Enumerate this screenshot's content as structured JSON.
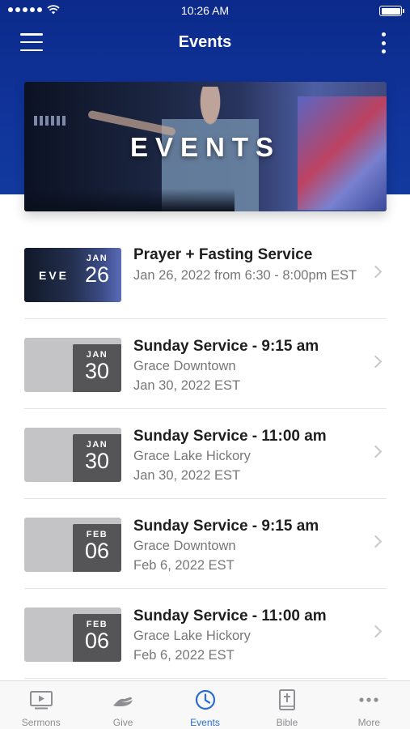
{
  "status_bar": {
    "time": "10:26 AM"
  },
  "nav": {
    "title": "Events"
  },
  "banner": {
    "text": "EVENTS"
  },
  "events": [
    {
      "title": "Prayer + Fasting Service",
      "line1": "Jan 26, 2022 from 6:30 - 8:00pm EST",
      "line2": "",
      "month": "JAN",
      "day": "26",
      "has_image": true,
      "thumb_text": "EVE"
    },
    {
      "title": "Sunday Service - 9:15 am",
      "line1": "Grace Downtown",
      "line2": "Jan 30, 2022 EST",
      "month": "JAN",
      "day": "30",
      "has_image": false
    },
    {
      "title": "Sunday Service - 11:00 am",
      "line1": "Grace Lake Hickory",
      "line2": "Jan 30, 2022 EST",
      "month": "JAN",
      "day": "30",
      "has_image": false
    },
    {
      "title": "Sunday Service - 9:15 am",
      "line1": "Grace Downtown",
      "line2": "Feb 6, 2022 EST",
      "month": "FEB",
      "day": "06",
      "has_image": false
    },
    {
      "title": "Sunday Service - 11:00 am",
      "line1": "Grace Lake Hickory",
      "line2": "Feb 6, 2022 EST",
      "month": "FEB",
      "day": "06",
      "has_image": false
    }
  ],
  "tabs": [
    {
      "label": "Sermons",
      "icon": "video-icon",
      "active": false
    },
    {
      "label": "Give",
      "icon": "give-hand-icon",
      "active": false
    },
    {
      "label": "Events",
      "icon": "clock-icon",
      "active": true
    },
    {
      "label": "Bible",
      "icon": "bible-icon",
      "active": false
    },
    {
      "label": "More",
      "icon": "more-dots-icon",
      "active": false
    }
  ],
  "colors": {
    "header": "#10339a",
    "accent": "#2a6dce",
    "badge": "#555557"
  }
}
